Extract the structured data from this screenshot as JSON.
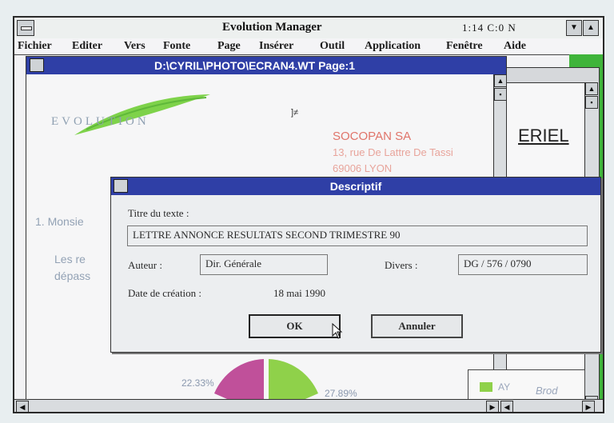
{
  "app": {
    "title": "Evolution Manager",
    "clock": "1:14  C:0    N",
    "menu": [
      "Fichier",
      "Editer",
      "Vers",
      "Fonte",
      "Page",
      "Insérer",
      "Outil",
      "Application",
      "Fenêtre",
      "Aide"
    ]
  },
  "document": {
    "title": "D:\\CYRIL\\PHOTO\\ECRAN4.WT Page:1",
    "logo_text": "EVOLUTION",
    "company_name": "SOCOPAN SA",
    "company_street": "13, rue De Lattre De Tassi",
    "company_city": "69006 LYON",
    "heading_fragment": "ERIEL",
    "cursor_mark": "]≠",
    "salutation": "1. Monsie",
    "body_line1": "Les re",
    "body_line2": "dépass",
    "pie_left_label": "22.33%",
    "pie_right_label": "27.89%",
    "legend_label": "AY",
    "legend_source": "Brod",
    "pie_colors": {
      "left": "#c0509a",
      "right": "#8fd14a"
    }
  },
  "dialog": {
    "title": "Descriptif",
    "title_label": "Titre du texte :",
    "title_value": "LETTRE ANNONCE RESULTATS SECOND TRIMESTRE 90",
    "author_label": "Auteur :",
    "author_value": "Dir. Générale",
    "misc_label": "Divers :",
    "misc_value": "DG / 576 / 0790",
    "date_label": "Date de création :",
    "date_value": "18 mai 1990",
    "ok_label": "OK",
    "cancel_label": "Annuler"
  },
  "colors": {
    "titlebar_active": "#2f3fa6",
    "green_strip": "#3fb43a",
    "company_text": "#e0746a"
  }
}
